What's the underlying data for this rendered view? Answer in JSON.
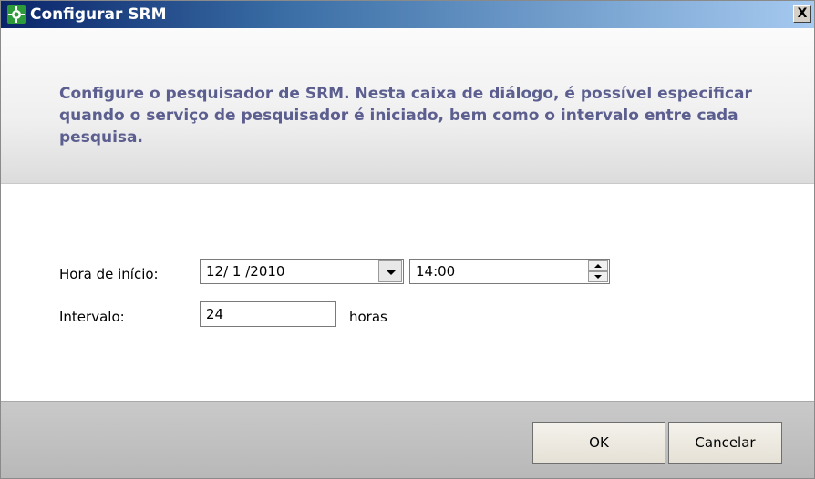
{
  "window": {
    "title": "Configurar SRM",
    "close_label": "X"
  },
  "header": {
    "description": "Configure o pesquisador de SRM. Nesta caixa de diálogo, é possível especificar quando o serviço de pesquisador é iniciado, bem como o intervalo entre cada pesquisa."
  },
  "form": {
    "start_label": "Hora de início:",
    "start_date": "12/ 1 /2010",
    "start_time": "14:00",
    "interval_label": "Intervalo:",
    "interval_value": "24",
    "interval_unit": "horas"
  },
  "buttons": {
    "ok": "OK",
    "cancel": "Cancelar"
  },
  "colors": {
    "title_gradient_start": "#0a246a",
    "title_gradient_end": "#a6caf0",
    "header_text": "#5b5e8f",
    "footer": "#c0c0c0"
  },
  "icons": {
    "app_icon": "srm-green-icon",
    "dropdown_icon": "chevron-down-icon",
    "spin_up_icon": "arrow-up-icon",
    "spin_down_icon": "arrow-down-icon"
  }
}
